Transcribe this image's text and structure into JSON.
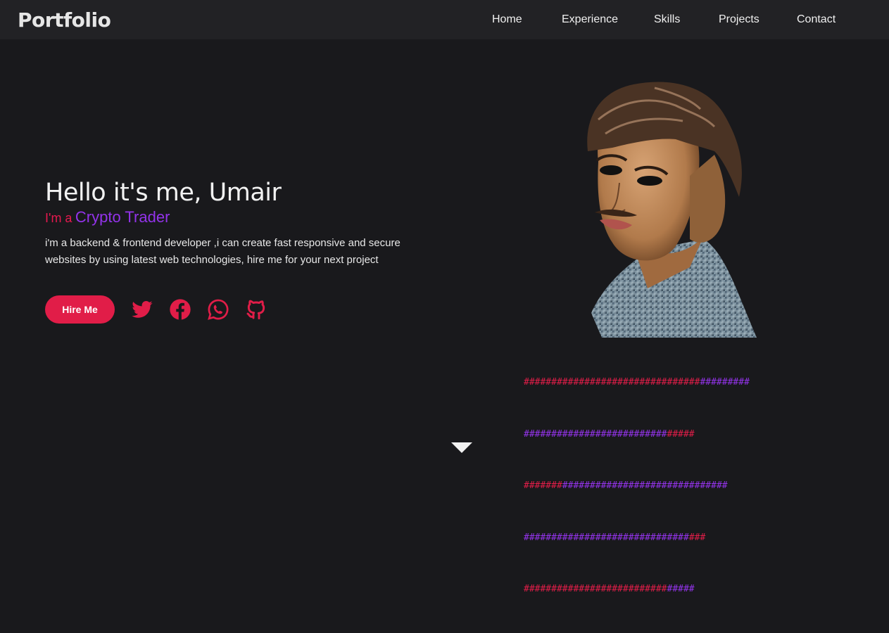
{
  "nav": {
    "logo": "Portfolio",
    "links": [
      {
        "label": "Home"
      },
      {
        "label": "Experience"
      },
      {
        "label": "Skills"
      },
      {
        "label": "Projects"
      },
      {
        "label": "Contact"
      }
    ]
  },
  "hero": {
    "greeting": "Hello it's me, Umair",
    "prefix": "I'm a",
    "role": "Crypto Trader",
    "description": "i'm a backend & frontend developer ,i can create fast responsive and secure websites by using latest web technologies, hire me for your next project",
    "hire_label": "Hire Me",
    "social": [
      {
        "icon": "twitter-icon"
      },
      {
        "icon": "facebook-icon"
      },
      {
        "icon": "whatsapp-icon"
      },
      {
        "icon": "github-icon"
      }
    ]
  },
  "decoration": {
    "hash_lines": [
      {
        "pink": "################################",
        "purple": "#########"
      },
      {
        "purple": "##########################",
        "pink": "#####"
      },
      {
        "pink": "#######",
        "purple": "##############################"
      },
      {
        "purple": "##############################",
        "pink": "###"
      },
      {
        "pink": "##########################",
        "purple": "#####"
      }
    ]
  },
  "colors": {
    "accent": "#e11d48",
    "purple": "#9333ea",
    "background": "#19191c",
    "nav_bg": "#222225"
  }
}
